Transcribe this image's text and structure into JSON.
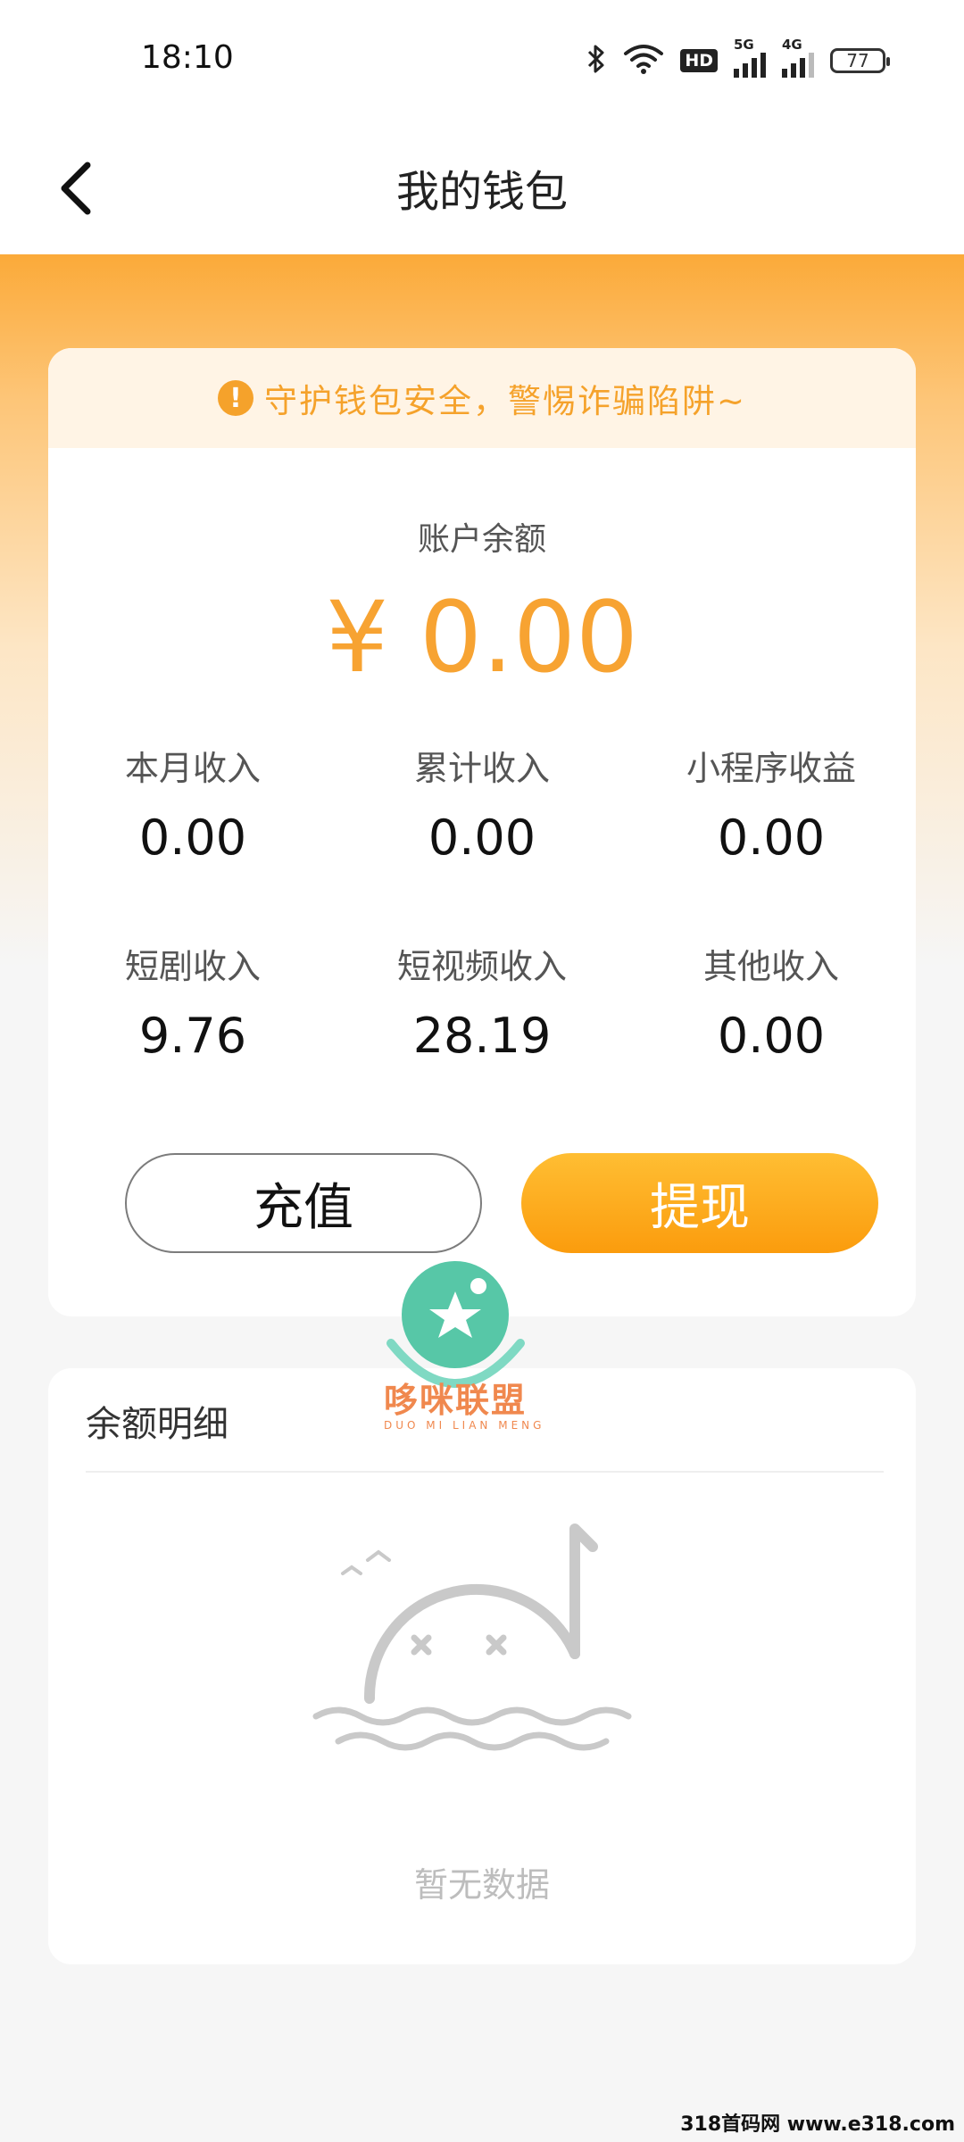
{
  "status_bar": {
    "time": "18:10",
    "hd_badge": "HD",
    "net1_label": "5G",
    "net2_label": "4G",
    "battery": "77",
    "icons": [
      "bluetooth-icon",
      "wifi-icon",
      "hd-icon",
      "signal-5g-icon",
      "signal-4g-icon",
      "battery-icon"
    ]
  },
  "header": {
    "title": "我的钱包",
    "back_icon": "chevron-left-icon"
  },
  "wallet": {
    "notice": "守护钱包安全，警惕诈骗陷阱~",
    "balance_label": "账户余额",
    "balance_amount": "¥ 0.00",
    "stats": [
      {
        "label": "本月收入",
        "value": "0.00"
      },
      {
        "label": "累计收入",
        "value": "0.00"
      },
      {
        "label": "小程序收益",
        "value": "0.00"
      },
      {
        "label": "短剧收入",
        "value": "9.76"
      },
      {
        "label": "短视频收入",
        "value": "28.19"
      },
      {
        "label": "其他收入",
        "value": "0.00"
      }
    ],
    "recharge_label": "充值",
    "withdraw_label": "提现"
  },
  "detail": {
    "title": "余额明细",
    "empty_text": "暂无数据"
  },
  "watermark": {
    "name": "哆咪联盟",
    "sub": "DUO MI LIAN MENG"
  },
  "footer": {
    "stamp": "318首码网 www.e318.com"
  },
  "colors": {
    "accent": "#f7a332",
    "button_gradient_top": "#ffbe33",
    "button_gradient_bottom": "#fb9c0d",
    "notice_bg": "#fff4e5"
  }
}
